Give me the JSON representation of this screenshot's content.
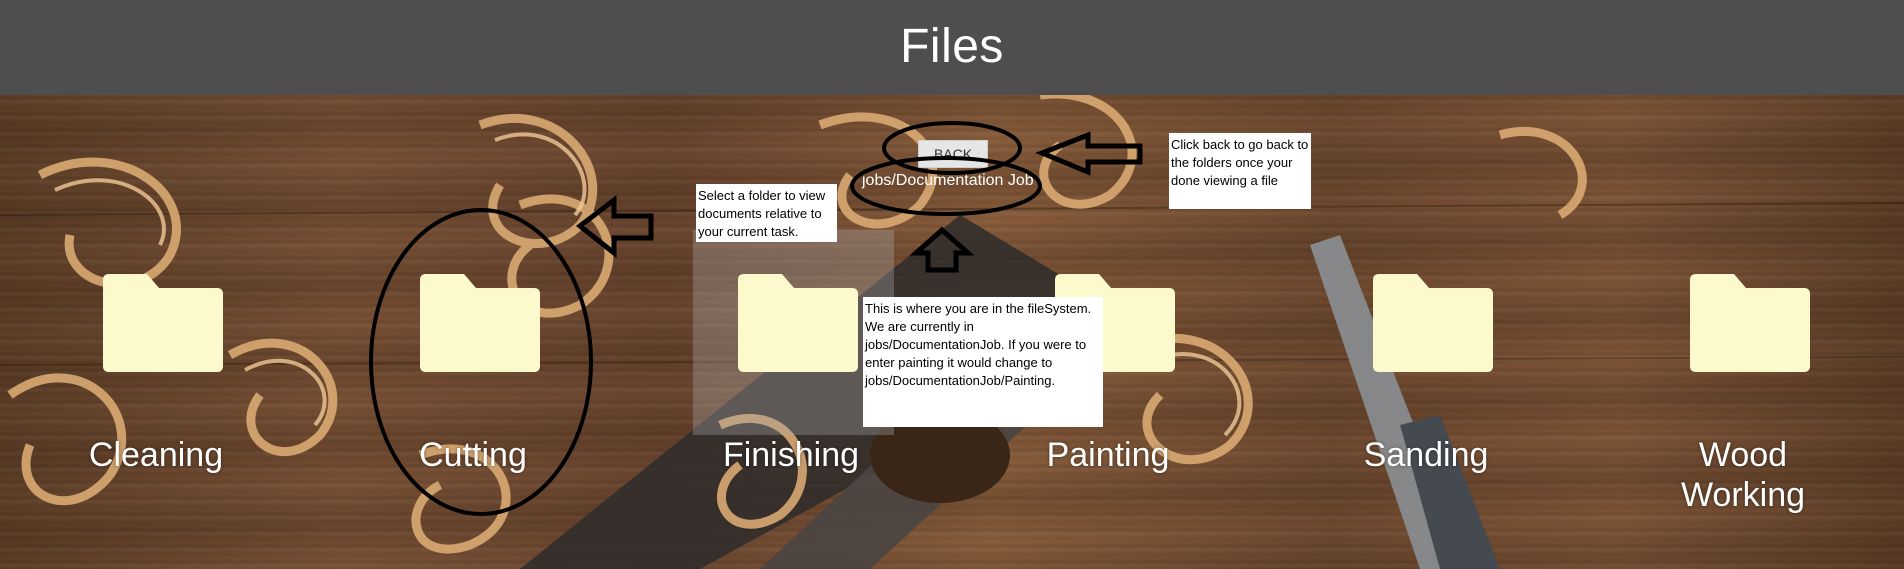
{
  "header": {
    "title": "Files"
  },
  "navigation": {
    "back_label": "BACK",
    "current_path": "jobs/Documentation Job"
  },
  "folders": [
    {
      "label": "Cleaning",
      "icon": "folder-icon"
    },
    {
      "label": "Cutting",
      "icon": "folder-icon"
    },
    {
      "label": "Finishing",
      "icon": "folder-icon"
    },
    {
      "label": "Painting",
      "icon": "folder-icon"
    },
    {
      "label": "Sanding",
      "icon": "folder-icon"
    },
    {
      "label": "Wood Working",
      "icon": "folder-icon"
    }
  ],
  "annotations": {
    "select_folder": "Select a folder to view documents relative to your current task.",
    "back_help": "Click back to go back to the folders once your done viewing a file",
    "location_help": "This is where you are in the fileSystem. We are currently in jobs/DocumentationJob. If you were to enter painting it would change to jobs/DocumentationJob/Painting."
  },
  "colors": {
    "header_bg": "#4e4e4e",
    "folder_fill": "#fcfacc",
    "label_text": "#ffffff"
  }
}
